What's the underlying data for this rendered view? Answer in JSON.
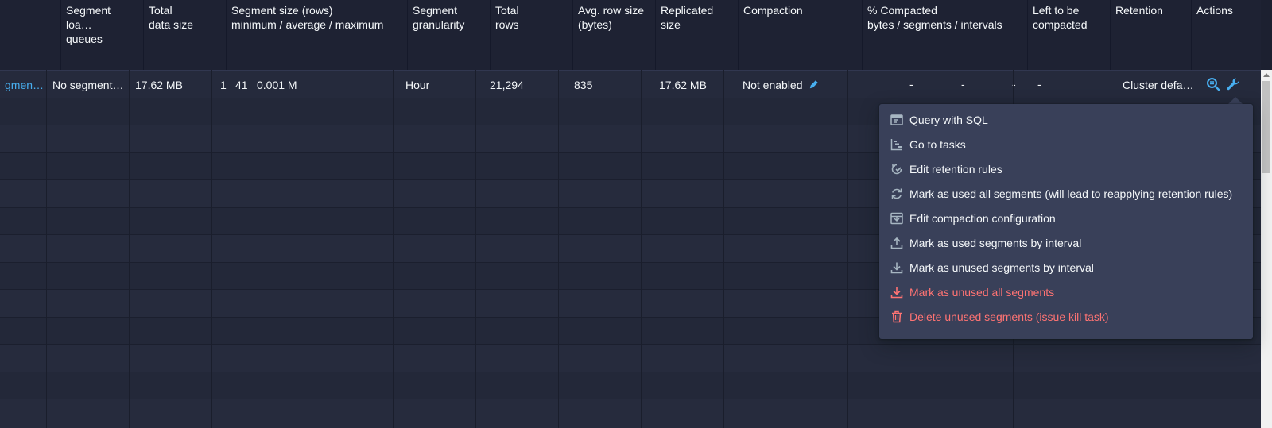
{
  "columns": [
    {
      "title": "",
      "name": "col-datasource"
    },
    {
      "title": "Segment loa…\nqueues",
      "name": "col-segment-load-queues"
    },
    {
      "title": "Total\ndata size",
      "name": "col-total-data-size"
    },
    {
      "title": "Segment size (rows)\nminimum / average / maximum",
      "name": "col-segment-size"
    },
    {
      "title": "Segment\ngranularity",
      "name": "col-segment-granularity"
    },
    {
      "title": "Total\nrows",
      "name": "col-total-rows"
    },
    {
      "title": "Avg. row size\n(bytes)",
      "name": "col-avg-row-size"
    },
    {
      "title": "Replicated\nsize",
      "name": "col-replicated-size"
    },
    {
      "title": "Compaction",
      "name": "col-compaction"
    },
    {
      "title": "% Compacted\nbytes / segments / intervals",
      "name": "col-pct-compacted"
    },
    {
      "title": "Left to be\ncompacted",
      "name": "col-left-to-compact"
    },
    {
      "title": "Retention",
      "name": "col-retention"
    },
    {
      "title": "Actions",
      "name": "col-actions"
    }
  ],
  "row": {
    "datasource": "gmen…",
    "segment_load_queues": "No segment…",
    "total_data_size": "17.62 MB",
    "seg_min": "1",
    "seg_avg": "41",
    "seg_max": "0.001 M",
    "granularity": "Hour",
    "total_rows": "21,294",
    "avg_row_size": "835",
    "replicated_size": "17.62 MB",
    "compaction": "Not enabled",
    "pct_bytes": "-",
    "pct_segments": "-",
    "pct_intervals": "-",
    "left_to_compact": "-",
    "retention": "Cluster defa…"
  },
  "menu": {
    "items": [
      {
        "label": "Query with SQL",
        "icon": "application-icon",
        "danger": false
      },
      {
        "label": "Go to tasks",
        "icon": "gantt-chart-icon",
        "danger": false
      },
      {
        "label": "Edit retention rules",
        "icon": "automatic-updates-icon",
        "danger": false
      },
      {
        "label": "Mark as used all segments (will lead to reapplying retention rules)",
        "icon": "refresh-icon",
        "danger": false
      },
      {
        "label": "Edit compaction configuration",
        "icon": "compressed-icon",
        "danger": false
      },
      {
        "label": "Mark as used segments by interval",
        "icon": "upload-icon",
        "danger": false
      },
      {
        "label": "Mark as unused segments by interval",
        "icon": "download-icon",
        "danger": false
      },
      {
        "label": "Mark as unused all segments",
        "icon": "download-icon",
        "danger": true
      },
      {
        "label": "Delete unused segments (issue kill task)",
        "icon": "trash-icon",
        "danger": true
      }
    ]
  },
  "colors": {
    "background": "#1c2030",
    "menu_background": "#394059",
    "link": "#48aff0",
    "danger": "#ff7373",
    "text": "#f5f8fa"
  }
}
